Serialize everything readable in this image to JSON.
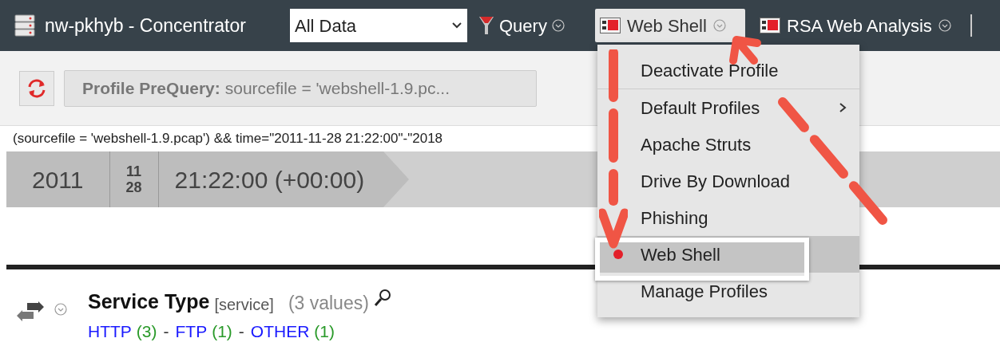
{
  "toolbar": {
    "title": "nw-pkhyb - Concentrator",
    "data_select": "All Data",
    "query_button": "Query",
    "profiles": [
      {
        "label": "Web Shell",
        "selected": true
      },
      {
        "label": "RSA Web Analysis",
        "selected": false
      }
    ]
  },
  "prequery": {
    "label": "Profile PreQuery:",
    "value": "sourcefile = 'webshell-1.9.pc..."
  },
  "query_text": "(sourcefile = 'webshell-1.9.pcap') && time=\"2011-11-28 21:22:00\"-\"2018",
  "time_bar": {
    "year": "2011",
    "month": "11",
    "day": "28",
    "time": "21:22:00 (+00:00)"
  },
  "meta": {
    "title": "Service Type",
    "key": "[service]",
    "count": "(3 values)",
    "separator": "-",
    "values": [
      {
        "label": "HTTP",
        "count": "(3)"
      },
      {
        "label": "FTP",
        "count": "(1)"
      },
      {
        "label": "OTHER",
        "count": "(1)"
      }
    ]
  },
  "menu": [
    {
      "kind": "action",
      "label": "Deactivate Profile",
      "selected": false
    },
    {
      "kind": "submenu",
      "label": "Default Profiles",
      "selected": false
    },
    {
      "kind": "profile",
      "label": "Apache Struts",
      "selected": false
    },
    {
      "kind": "profile",
      "label": "Drive By Download",
      "selected": false
    },
    {
      "kind": "profile",
      "label": "Phishing",
      "selected": false
    },
    {
      "kind": "profile",
      "label": "Web Shell",
      "selected": true
    },
    {
      "kind": "action",
      "label": "Manage Profiles",
      "selected": false
    }
  ]
}
